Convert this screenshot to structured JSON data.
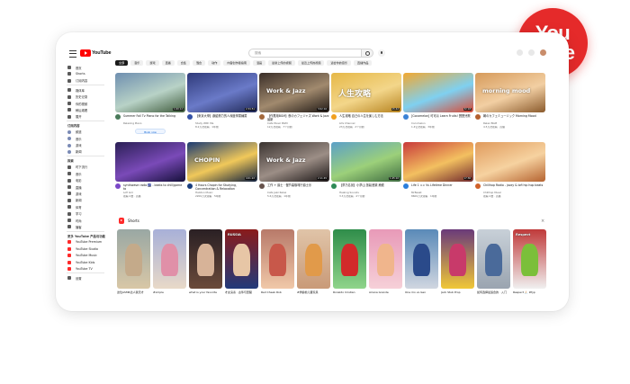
{
  "badge": {
    "line1": "You",
    "line2": "Tube",
    "color": "#e52a2a"
  },
  "header": {
    "logo_text": "YouTube",
    "search_placeholder": "搜索"
  },
  "sidebar": {
    "items": [
      {
        "label": "首页",
        "icon": "home-icon"
      },
      {
        "label": "Shorts",
        "icon": "shorts-icon"
      },
      {
        "label": "订阅内容",
        "icon": "subscriptions-icon"
      },
      {
        "label": "媒体库",
        "icon": "library-icon"
      },
      {
        "label": "历史记录",
        "icon": "history-icon"
      },
      {
        "label": "你的视频",
        "icon": "your-videos-icon"
      },
      {
        "label": "稍后观看",
        "icon": "watch-later-icon"
      },
      {
        "label": "展开",
        "icon": "chevron-down-icon"
      }
    ],
    "subs_head": "订阅内容",
    "subs": [
      {
        "label": "频道"
      },
      {
        "label": "音乐"
      },
      {
        "label": "游戏"
      },
      {
        "label": "新闻"
      }
    ],
    "explore_head": "探索",
    "explore": [
      {
        "label": "时下流行"
      },
      {
        "label": "音乐"
      },
      {
        "label": "电影"
      },
      {
        "label": "直播"
      },
      {
        "label": "游戏"
      },
      {
        "label": "新闻"
      },
      {
        "label": "体育"
      },
      {
        "label": "学习"
      },
      {
        "label": "时尚"
      },
      {
        "label": "播客"
      }
    ],
    "more_head": "更多 YouTube 产品与功能",
    "more": [
      {
        "label": "YouTube Premium"
      },
      {
        "label": "YouTube Studio"
      },
      {
        "label": "YouTube Music"
      },
      {
        "label": "YouTube Kids"
      },
      {
        "label": "YouTube TV"
      }
    ],
    "settings": "设置"
  },
  "chips": [
    "全部",
    "音乐",
    "游戏",
    "直播",
    "合集",
    "混合",
    "动作",
    "内容创作者指南",
    "漫画",
    "最新上传的视频",
    "最近上传的视频",
    "适合你的音乐",
    "直播作品"
  ],
  "videos": [
    {
      "title": "Summer Fall Tv Piano for the Talking",
      "channel": "Relaxing Piano",
      "meta": "",
      "duration": "1:00:12",
      "thumb_colors": [
        "#6f8fb0",
        "#b8d2c6",
        "#3e5a3a"
      ],
      "overlay": "",
      "avatar": "#4a7a5a",
      "cta": "Book now"
    },
    {
      "title": "【東京大學】獻給努力的人深度學習練習",
      "channel": "Study With Me",
      "meta": "8.2万次观看 · 1年前",
      "duration": "2:34:51",
      "thumb_colors": [
        "#2f3a7a",
        "#6a7ac8",
        "#202855"
      ],
      "overlay": "",
      "avatar": "#3452a6",
      "cta": ""
    },
    {
      "title": "【作業用BGM】夜のカフェジャズ Work & Jazz 最新",
      "channel": "Cafe Music BGM",
      "meta": "12万次观看 · 7个月前",
      "duration": "3:02:16",
      "thumb_colors": [
        "#3a2e28",
        "#a18a6e",
        "#1f1814"
      ],
      "overlay": "Work & Jazz",
      "avatar": "#a3693b",
      "cta": ""
    },
    {
      "title": "人生攻略 自己の人生を楽しむ方法",
      "channel": "Life Channel",
      "meta": "23万次观看 · 2个月前",
      "duration": "15:42",
      "thumb_colors": [
        "#e6b847",
        "#f3d68a",
        "#b68320"
      ],
      "overlay": "人生攻略",
      "avatar": "#f1a020",
      "cta": ""
    },
    {
      "title": "[Cocomelon] 可可瓜 Learn Fruits! 寶寶兒歌",
      "channel": "Cocomelon",
      "meta": "1.4亿次观看 · 3年前",
      "duration": "32:18",
      "thumb_colors": [
        "#f2a830",
        "#7fd0f0",
        "#d84a36"
      ],
      "overlay": "",
      "avatar": "#3b83d6",
      "cta": ""
    },
    {
      "title": "朝のカフェミュージック Morning Mood",
      "channel": "Relax BGM",
      "meta": "4.5万次观看 · 直播",
      "duration": "",
      "thumb_colors": [
        "#d69a5a",
        "#f2cfa3",
        "#8a5a2c"
      ],
      "overlay": "morning mood",
      "avatar": "#b4602f",
      "cta": ""
    },
    {
      "title": "synthwave radio 🌌 - beats to chill/game to",
      "channel": "Lofi Girl",
      "meta": "观看人数 · 直播",
      "duration": "",
      "thumb_colors": [
        "#2a1f55",
        "#7a4ab8",
        "#15103a"
      ],
      "overlay": "",
      "avatar": "#7b48c8",
      "cta": ""
    },
    {
      "title": "4 Hours Chopin for Studying, Concentration & Relaxation",
      "channel": "Halidon Music",
      "meta": "2200万次观看 · 5年前",
      "duration": "4:01:22",
      "thumb_colors": [
        "#1b3a72",
        "#f0c85a",
        "#0d1d3d"
      ],
      "overlay": "CHOPIN",
      "avatar": "#1a3e7d",
      "cta": ""
    },
    {
      "title": "工作 + 爵士 · 慢节奏咖啡厅爵士乐",
      "channel": "Cafe Jazz Relax",
      "meta": "5.6万次观看 · 1年前",
      "duration": "2:11:45",
      "thumb_colors": [
        "#3a3330",
        "#9c8e86",
        "#1a1515"
      ],
      "overlay": "Work & Jazz",
      "avatar": "#66534c",
      "cta": ""
    },
    {
      "title": "【夢乃名景】小夢山 放鬆音樂 療癒",
      "channel": "Healing Sounds",
      "meta": "3.3万次观看 · 4个月前",
      "duration": "1:45:10",
      "thumb_colors": [
        "#5ba0c8",
        "#9cd07a",
        "#3d6a40"
      ],
      "overlay": "",
      "avatar": "#2e8a56",
      "cta": ""
    },
    {
      "title": "Life 1 ∞∞ Vs Lifetime Dinner",
      "channel": "MrBeast",
      "meta": "8600万次观看 · 1年前",
      "duration": "17:36",
      "thumb_colors": [
        "#c83a3a",
        "#f3c060",
        "#70282d"
      ],
      "overlay": "",
      "avatar": "#2c7fdc",
      "cta": ""
    },
    {
      "title": "Chillhop Radio - jazzy & lofi hip hop beats",
      "channel": "Chillhop Music",
      "meta": "观看人数 · 直播",
      "duration": "",
      "thumb_colors": [
        "#e09a5c",
        "#f6d2a0",
        "#b56330"
      ],
      "overlay": "",
      "avatar": "#d0612a",
      "cta": ""
    }
  ],
  "shorts_head": "Shorts",
  "shorts": [
    {
      "title": "这位ASMR达人我天才",
      "colors": [
        "#9aa8a4",
        "#d8c7a6"
      ],
      "fig": "#c4aa8a",
      "lbl": ""
    },
    {
      "title": "#xmple",
      "colors": [
        "#a8b0d8",
        "#e8d9c8"
      ],
      "fig": "#e090a8",
      "lbl": ""
    },
    {
      "title": "what is your favorite",
      "colors": [
        "#2a2024",
        "#6a4a3a"
      ],
      "fig": "#d7b398",
      "lbl": ""
    },
    {
      "title": "才女演奏 · 古筝与琵琶",
      "colors": [
        "#8a1b1b",
        "#223a7a"
      ],
      "fig": "#e7c6a6",
      "lbl": "RUSSIA"
    },
    {
      "title": "Red Cheek Rob",
      "colors": [
        "#b87a6a",
        "#f0c8a8"
      ],
      "fig": "#c8584a",
      "lbl": ""
    },
    {
      "title": "#学龄前儿童玩具",
      "colors": [
        "#e0c4a8",
        "#c99a78"
      ],
      "fig": "#e19a4a",
      "lbl": ""
    },
    {
      "title": "Ronaldo Cristian",
      "colors": [
        "#2f8d4a",
        "#8fd48a"
      ],
      "fig": "#d22a2a",
      "lbl": ""
    },
    {
      "title": "Ariana Grande",
      "colors": [
        "#e89ab8",
        "#f6d0d8"
      ],
      "fig": "#f0b58c",
      "lbl": ""
    },
    {
      "title": "One mo vs Gen",
      "colors": [
        "#5a8ab8",
        "#d0d6e0"
      ],
      "fig": "#2a4a8a",
      "lbl": ""
    },
    {
      "title": "Jack Stub Prop",
      "colors": [
        "#6a3a7a",
        "#f0c838"
      ],
      "fig": "#c83a6a",
      "lbl": ""
    },
    {
      "title": "如何选择最适合的 · 入门",
      "colors": [
        "#c8d0d8",
        "#9aa4b0"
      ],
      "fig": "#4a6a9a",
      "lbl": ""
    },
    {
      "title": "Respect 🙏🏻 #fyp",
      "colors": [
        "#c03a3a",
        "#f0f0f0"
      ],
      "fig": "#7bbf3a",
      "lbl": "Respect"
    }
  ]
}
